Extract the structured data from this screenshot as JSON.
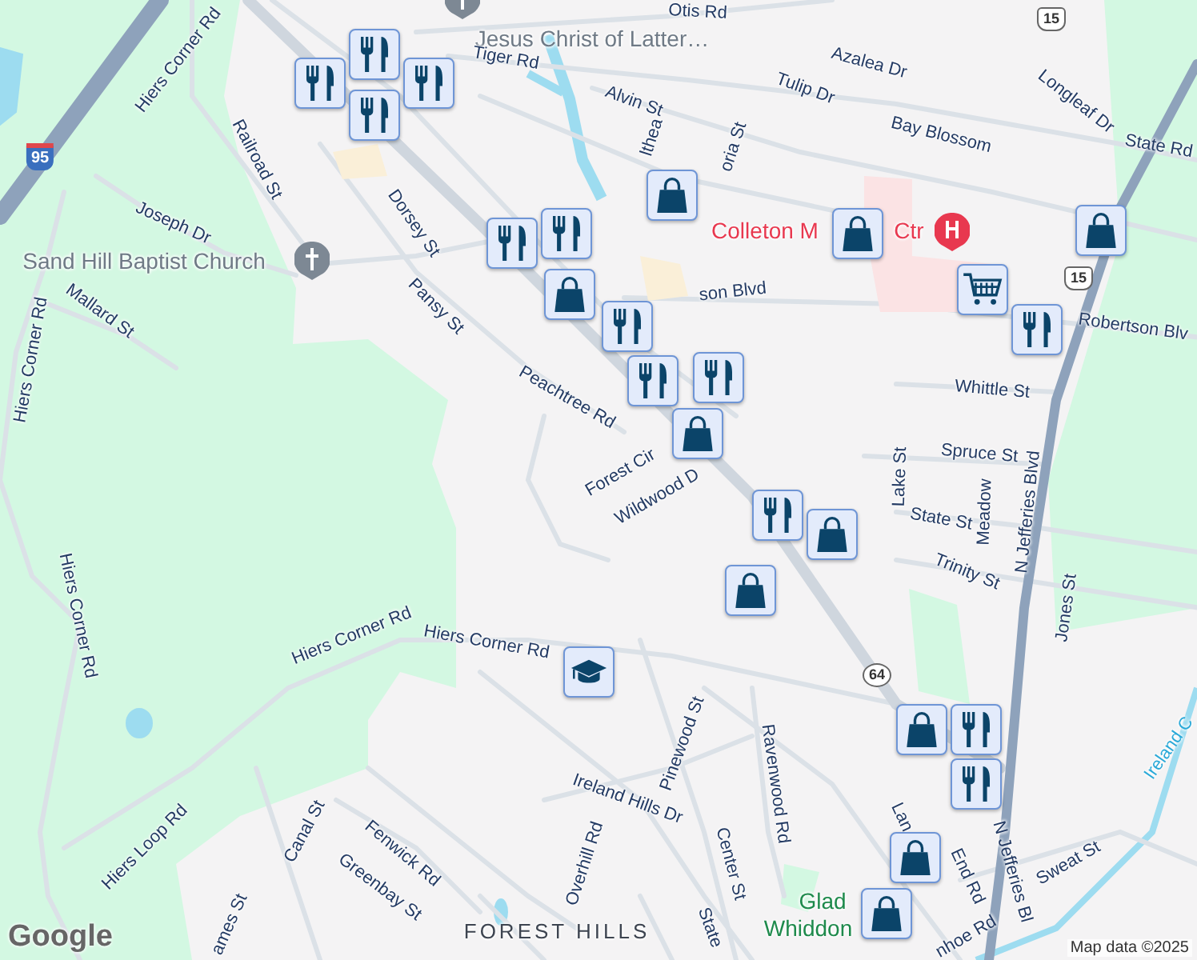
{
  "map": {
    "labels": [
      {
        "text": "Jesus Christ of Latter…",
        "kind": "poi"
      },
      {
        "text": "Otis Rd",
        "kind": "street"
      },
      {
        "text": "Hiers Corner Rd",
        "kind": "street"
      },
      {
        "text": "Tiger Rd",
        "kind": "street"
      },
      {
        "text": "Azalea Dr",
        "kind": "street"
      },
      {
        "text": "Alvin St",
        "kind": "street"
      },
      {
        "text": "Tulip Dr",
        "kind": "street"
      },
      {
        "text": "Longleaf Dr",
        "kind": "street"
      },
      {
        "text": "Bay Blossom",
        "kind": "street"
      },
      {
        "text": "State Rd",
        "kind": "street"
      },
      {
        "text": "Railroad St",
        "kind": "street"
      },
      {
        "text": "lthea",
        "kind": "street"
      },
      {
        "text": "oria St",
        "kind": "street"
      },
      {
        "text": "Joseph Dr",
        "kind": "street"
      },
      {
        "text": "Dorsey St",
        "kind": "street"
      },
      {
        "text": "Colleton M",
        "kind": "hospital"
      },
      {
        "text": "Ctr",
        "kind": "hospital"
      },
      {
        "text": "Sand Hill Baptist Church",
        "kind": "poi"
      },
      {
        "text": "son Blvd",
        "kind": "street"
      },
      {
        "text": "Mallard St",
        "kind": "street"
      },
      {
        "text": "Pansy St",
        "kind": "street"
      },
      {
        "text": "Robertson Blv",
        "kind": "street"
      },
      {
        "text": "Hiers Corner Rd",
        "kind": "street"
      },
      {
        "text": "Whittle St",
        "kind": "street"
      },
      {
        "text": "Peachtree Rd",
        "kind": "street"
      },
      {
        "text": "Spruce St",
        "kind": "street"
      },
      {
        "text": "Forest Cir",
        "kind": "street"
      },
      {
        "text": "Lake St",
        "kind": "street"
      },
      {
        "text": "Wildwood D",
        "kind": "street"
      },
      {
        "text": "Meadow",
        "kind": "street"
      },
      {
        "text": "State St",
        "kind": "street"
      },
      {
        "text": "N Jefferies Blvd",
        "kind": "street"
      },
      {
        "text": "Trinity St",
        "kind": "street"
      },
      {
        "text": "Hiers Corner Rd",
        "kind": "street"
      },
      {
        "text": "Jones St",
        "kind": "street"
      },
      {
        "text": "Hiers Corner Rd",
        "kind": "street"
      },
      {
        "text": "Hiers Corner Rd",
        "kind": "street"
      },
      {
        "text": "Pinewood St",
        "kind": "street"
      },
      {
        "text": "Ravenwood Rd",
        "kind": "street"
      },
      {
        "text": "Ireland C",
        "kind": "water"
      },
      {
        "text": "Ireland Hills Dr",
        "kind": "street"
      },
      {
        "text": "Hiers Loop Rd",
        "kind": "street"
      },
      {
        "text": "Canal St",
        "kind": "street"
      },
      {
        "text": "Fenwick Rd",
        "kind": "street"
      },
      {
        "text": "Greenbay St",
        "kind": "street"
      },
      {
        "text": "Overhill Rd",
        "kind": "street"
      },
      {
        "text": "Center St",
        "kind": "street"
      },
      {
        "text": "Lan",
        "kind": "street"
      },
      {
        "text": "End Rd",
        "kind": "street"
      },
      {
        "text": "N Jefferies Bl",
        "kind": "street"
      },
      {
        "text": "Sweat St",
        "kind": "street"
      },
      {
        "text": "Glad",
        "kind": "park"
      },
      {
        "text": "Whiddon",
        "kind": "park"
      },
      {
        "text": "ames St",
        "kind": "street"
      },
      {
        "text": "State",
        "kind": "street"
      },
      {
        "text": "FOREST HILLS",
        "kind": "area"
      },
      {
        "text": "nhoe Rd",
        "kind": "street"
      }
    ],
    "shields": [
      {
        "text": "95",
        "kind": "interstate"
      },
      {
        "text": "15",
        "kind": "us"
      },
      {
        "text": "15",
        "kind": "us"
      },
      {
        "text": "64",
        "kind": "state"
      }
    ],
    "markers": [
      {
        "kind": "restaurant"
      },
      {
        "kind": "restaurant"
      },
      {
        "kind": "restaurant"
      },
      {
        "kind": "restaurant"
      },
      {
        "kind": "restaurant"
      },
      {
        "kind": "restaurant"
      },
      {
        "kind": "shopping"
      },
      {
        "kind": "restaurant"
      },
      {
        "kind": "restaurant"
      },
      {
        "kind": "shopping"
      },
      {
        "kind": "shopping"
      },
      {
        "kind": "grocery"
      },
      {
        "kind": "restaurant"
      },
      {
        "kind": "shopping"
      },
      {
        "kind": "restaurant"
      },
      {
        "kind": "shopping"
      },
      {
        "kind": "restaurant"
      },
      {
        "kind": "shopping"
      },
      {
        "kind": "shopping"
      },
      {
        "kind": "school"
      },
      {
        "kind": "shopping"
      },
      {
        "kind": "restaurant"
      },
      {
        "kind": "restaurant"
      },
      {
        "kind": "shopping"
      },
      {
        "kind": "shopping"
      }
    ],
    "logo": "Google",
    "attribution": "Map data ©2025"
  }
}
